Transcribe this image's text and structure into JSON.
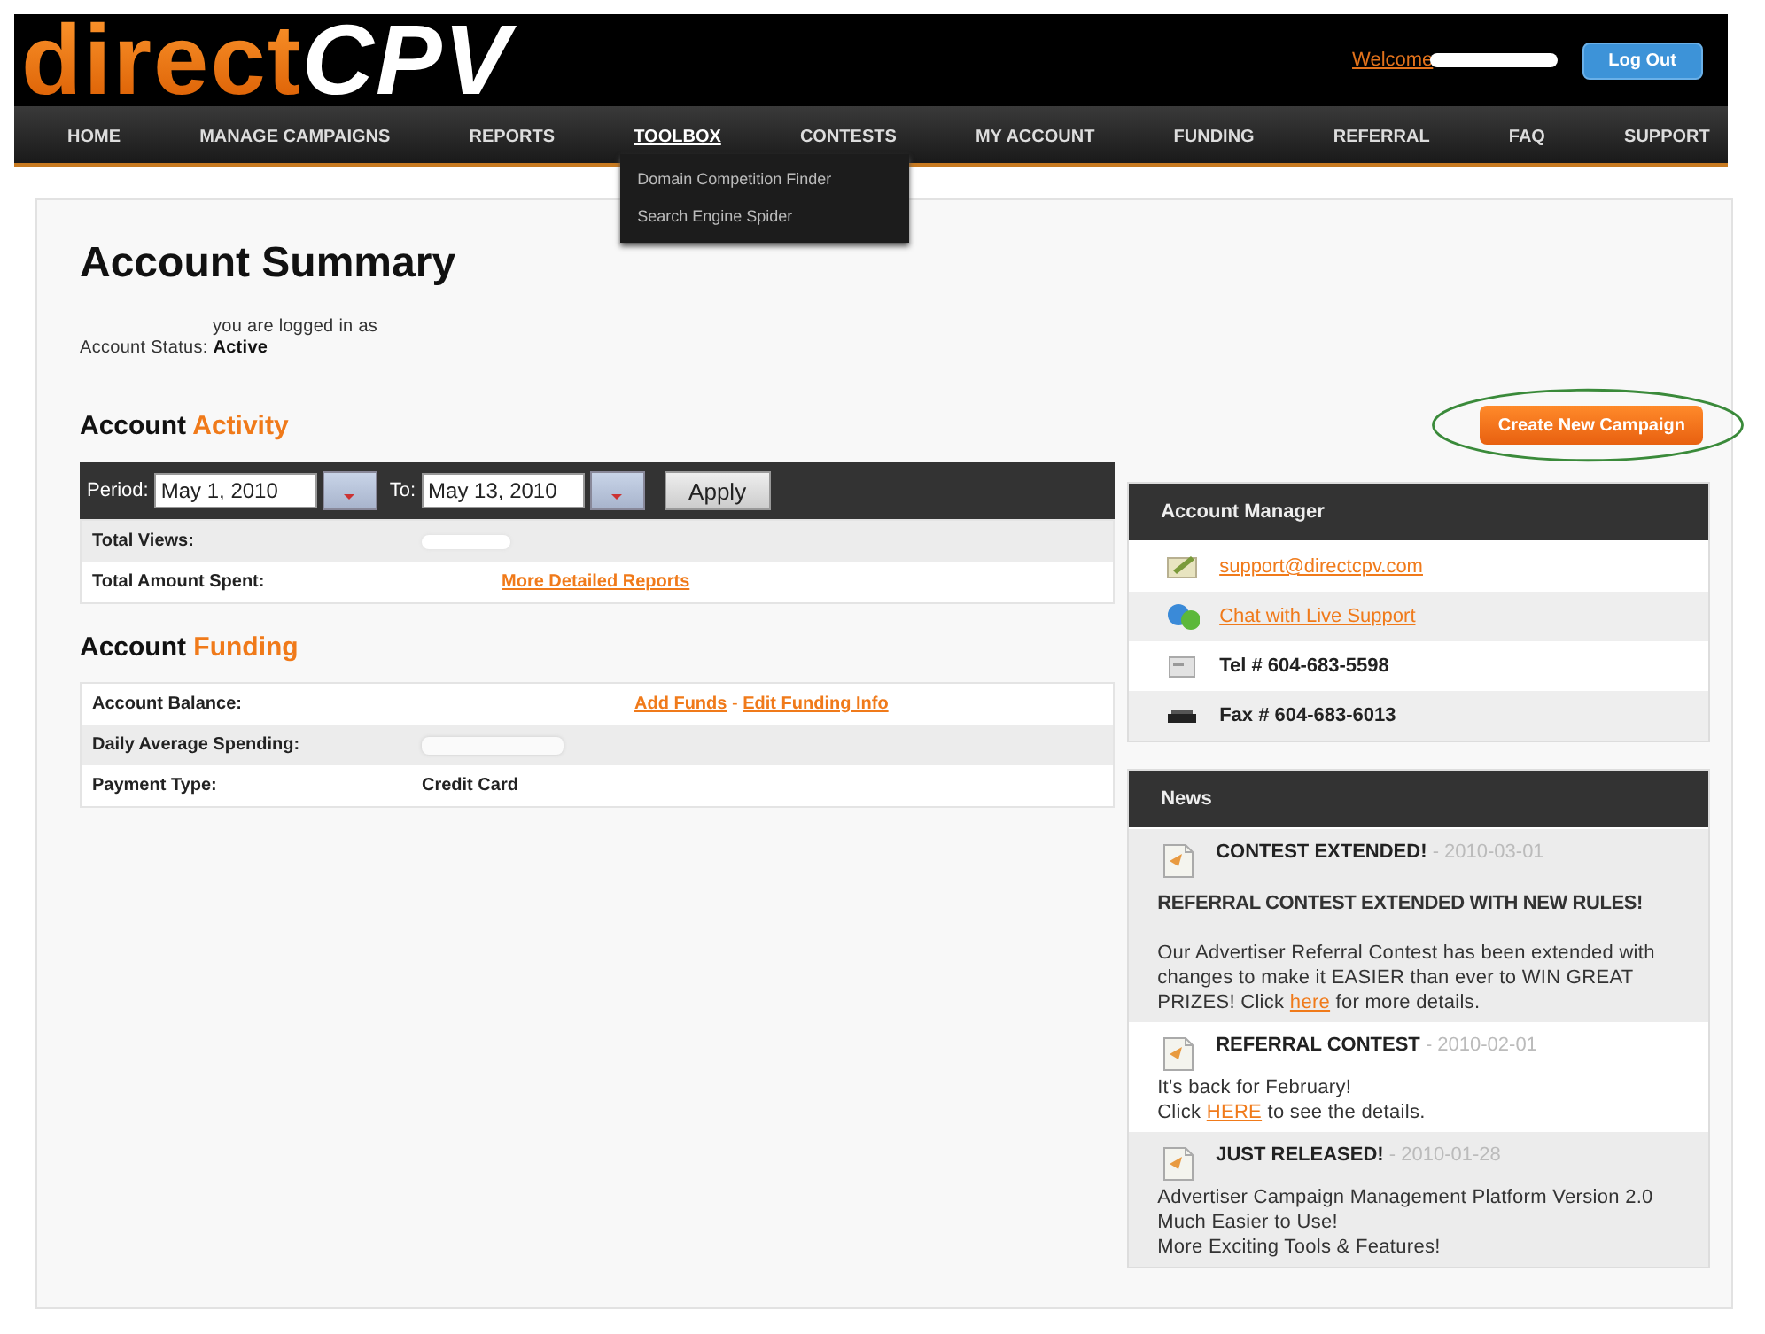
{
  "header": {
    "logo": [
      {
        "kind": "accent",
        "text": "direct"
      },
      {
        "kind": "plain",
        "text": "CPV"
      }
    ],
    "welcome": "Welcome",
    "name_redacted": true,
    "logout": "Log Out"
  },
  "nav": [
    {
      "label": "HOME",
      "selected": false
    },
    {
      "label": "MANAGE CAMPAIGNS",
      "selected": false
    },
    {
      "label": "REPORTS",
      "selected": false
    },
    {
      "label": "TOOLBOX",
      "selected": true,
      "menu": [
        "Domain Competition Finder",
        "Search Engine Spider"
      ]
    },
    {
      "label": "CONTESTS",
      "selected": false
    },
    {
      "label": "MY ACCOUNT",
      "selected": false
    },
    {
      "label": "FUNDING",
      "selected": false
    },
    {
      "label": "REFERRAL",
      "selected": false
    },
    {
      "label": "FAQ",
      "selected": false
    },
    {
      "label": "SUPPORT",
      "selected": false
    }
  ],
  "summary": {
    "title": "Account Summary",
    "logged_in": "you are logged in as",
    "status_label": "Account Status:",
    "status": "Active"
  },
  "activity": {
    "title": [
      "Account",
      "Activity"
    ],
    "period_label": "Period:",
    "from": "May 1, 2010",
    "to_label": "To:",
    "to": "May 13, 2010",
    "apply": "Apply",
    "rows": [
      {
        "label": "Total Views:",
        "redacted": true
      },
      {
        "label": "Total Amount Spent:",
        "redacted": false,
        "links": [
          "More Detailed Reports"
        ]
      }
    ]
  },
  "funding": {
    "title": [
      "Account",
      "Funding"
    ],
    "rows": [
      {
        "label": "Account Balance:",
        "redacted": false,
        "links": [
          "Add Funds",
          "Edit Funding Info"
        ],
        "separator": "-"
      },
      {
        "label": "Daily Average Spending:",
        "redacted": true
      },
      {
        "label": "Payment Type:",
        "redacted": false,
        "value": "Credit Card"
      }
    ]
  },
  "create_button": "Create New Campaign",
  "account_manager": {
    "title": "Account Manager",
    "rows": [
      {
        "kind": "link",
        "text": "support@directcpv.com"
      },
      {
        "kind": "link",
        "text": "Chat with Live Support"
      },
      {
        "kind": "text",
        "text": "Tel # 604-683-5598"
      },
      {
        "kind": "text",
        "text": "Fax # 604-683-6013"
      }
    ]
  },
  "news": {
    "title": "News",
    "items": [
      {
        "title": "CONTEST EXTENDED!",
        "date": "- 2010-03-01",
        "paragraphs": [
          {
            "kind": "headline",
            "parts": [
              {
                "kind": "text",
                "text": "REFERRAL CONTEST EXTENDED WITH NEW RULES!"
              }
            ]
          },
          {
            "kind": "body",
            "parts": [
              {
                "kind": "text",
                "text": "Our Advertiser Referral Contest has been extended with changes to make it EASIER than ever to WIN GREAT PRIZES! Click "
              },
              {
                "kind": "link",
                "text": "here"
              },
              {
                "kind": "text",
                "text": " for more details."
              }
            ]
          }
        ]
      },
      {
        "title": "REFERRAL CONTEST",
        "date": "- 2010-02-01",
        "paragraphs": [
          {
            "kind": "line",
            "parts": [
              {
                "kind": "text",
                "text": "It's back for February!"
              }
            ]
          },
          {
            "kind": "line",
            "parts": [
              {
                "kind": "text",
                "text": "Click "
              },
              {
                "kind": "link",
                "text": "HERE"
              },
              {
                "kind": "text",
                "text": " to see the details."
              }
            ]
          }
        ]
      },
      {
        "title": "JUST RELEASED!",
        "date": "- 2010-01-28",
        "paragraphs": [
          {
            "kind": "line",
            "parts": [
              {
                "kind": "text",
                "text": "Advertiser Campaign Management Platform Version 2.0"
              }
            ]
          },
          {
            "kind": "line",
            "parts": [
              {
                "kind": "text",
                "text": "Much Easier to Use!"
              }
            ]
          },
          {
            "kind": "line",
            "parts": [
              {
                "kind": "text",
                "text": "More Exciting Tools & Features!"
              }
            ]
          }
        ]
      }
    ]
  }
}
